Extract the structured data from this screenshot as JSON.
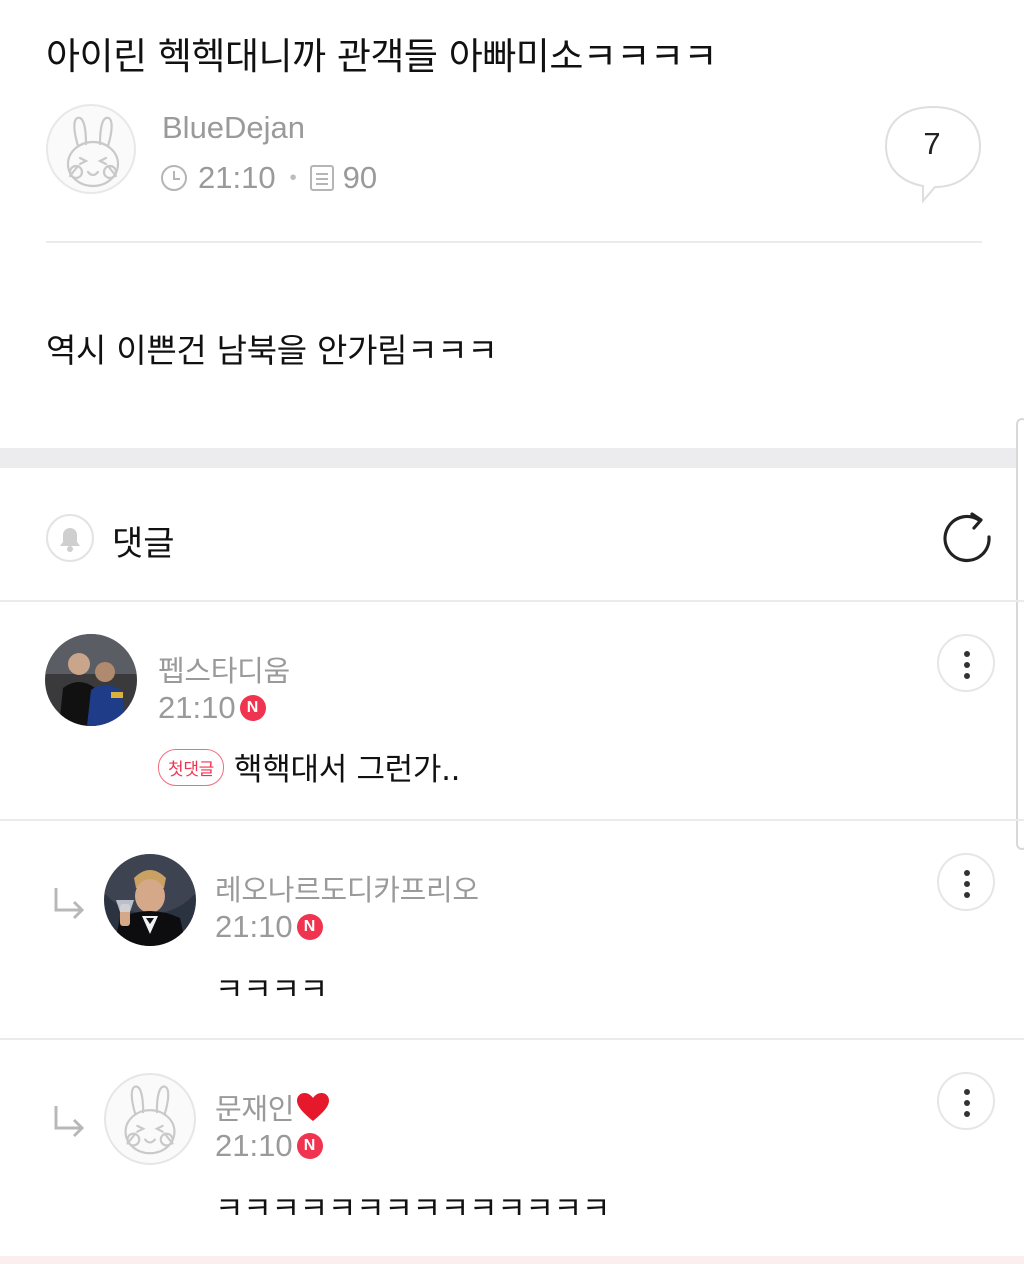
{
  "post": {
    "title": "아이린 헥헥대니까 관객들 아빠미소ㅋㅋㅋㅋ",
    "author": "BlueDejan",
    "time": "21:10",
    "views": "90",
    "comment_count": "7",
    "body": "역시 이쁜건 남북을 안가림ㅋㅋㅋ"
  },
  "comments_header": {
    "label": "댓글"
  },
  "comments": [
    {
      "name": "펩스타디움",
      "time": "21:10",
      "badge": "N",
      "tag": "첫댓글",
      "text": "핵핵대서 그런가..",
      "avatar": "photo-avatar"
    },
    {
      "name": "레오나르도디카프리오",
      "time": "21:10",
      "badge": "N",
      "text": "ㅋㅋㅋㅋ",
      "avatar": "photo-avatar",
      "reply": true
    },
    {
      "name": "문재인",
      "name_icon": "heart-icon",
      "time": "21:10",
      "badge": "N",
      "text": "ㅋㅋㅋㅋㅋㅋㅋㅋㅋㅋㅋㅋㅋㅋ",
      "avatar": "bunny-avatar",
      "reply": true
    }
  ],
  "colors": {
    "new_badge": "#f0344f",
    "meta_gray": "#9a9a9a",
    "section_gap": "#ececef"
  }
}
